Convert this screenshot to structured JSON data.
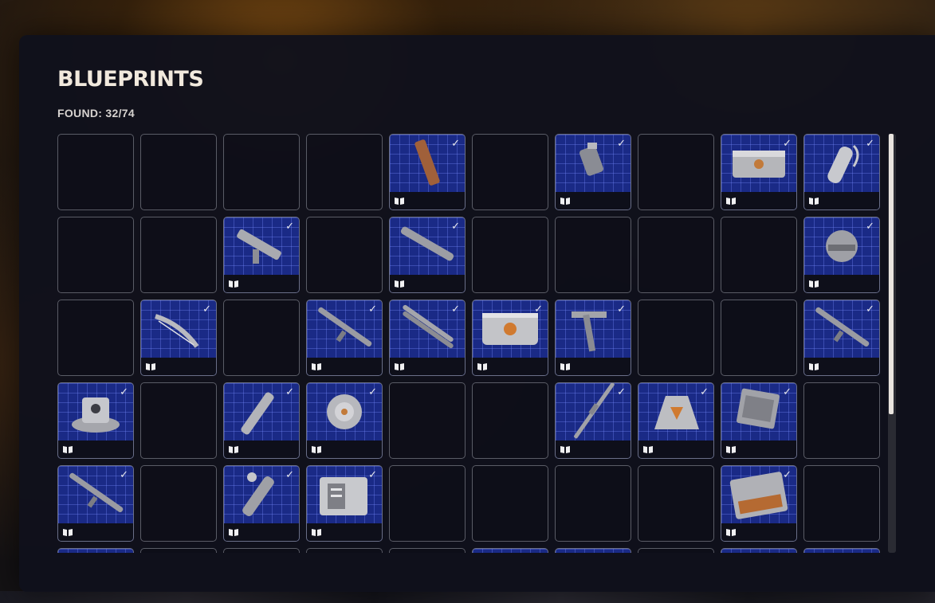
{
  "header": {
    "title": "BLUEPRINTS",
    "found_text": "FOUND: 32/74"
  },
  "colors": {
    "found_bg": "#1a2a86",
    "panel_bg": "#10111c",
    "title": "#f1e9dd"
  },
  "grid": {
    "columns": 10,
    "cells": [
      {
        "found": false
      },
      {
        "found": false
      },
      {
        "found": false
      },
      {
        "found": false
      },
      {
        "found": true,
        "icon": "canister-icon"
      },
      {
        "found": false
      },
      {
        "found": true,
        "icon": "device-icon"
      },
      {
        "found": false
      },
      {
        "found": true,
        "icon": "crate-icon"
      },
      {
        "found": true,
        "icon": "tank-icon"
      },
      {
        "found": false
      },
      {
        "found": false
      },
      {
        "found": true,
        "icon": "smg-icon"
      },
      {
        "found": false
      },
      {
        "found": true,
        "icon": "launcher-icon"
      },
      {
        "found": false
      },
      {
        "found": false
      },
      {
        "found": false
      },
      {
        "found": false
      },
      {
        "found": true,
        "icon": "helmet-icon"
      },
      {
        "found": false
      },
      {
        "found": true,
        "icon": "bow-icon"
      },
      {
        "found": false
      },
      {
        "found": true,
        "icon": "rifle-icon"
      },
      {
        "found": true,
        "icon": "shotgun-icon"
      },
      {
        "found": true,
        "icon": "supply-crate-icon"
      },
      {
        "found": true,
        "icon": "tool-icon"
      },
      {
        "found": false
      },
      {
        "found": false
      },
      {
        "found": true,
        "icon": "rifle-icon"
      },
      {
        "found": true,
        "icon": "turret-icon"
      },
      {
        "found": false
      },
      {
        "found": true,
        "icon": "flashlight-icon"
      },
      {
        "found": true,
        "icon": "mine-icon"
      },
      {
        "found": false
      },
      {
        "found": false
      },
      {
        "found": true,
        "icon": "sniper-icon"
      },
      {
        "found": true,
        "icon": "beacon-icon"
      },
      {
        "found": true,
        "icon": "shield-icon"
      },
      {
        "found": false
      },
      {
        "found": true,
        "icon": "rifle-icon"
      },
      {
        "found": false
      },
      {
        "found": true,
        "icon": "grenade-launcher-icon"
      },
      {
        "found": true,
        "icon": "ammo-box-icon"
      },
      {
        "found": false
      },
      {
        "found": false
      },
      {
        "found": false
      },
      {
        "found": false
      },
      {
        "found": true,
        "icon": "toolcase-icon"
      },
      {
        "found": false
      },
      {
        "found": true,
        "icon": "rifle-icon"
      },
      {
        "found": false
      },
      {
        "found": false
      },
      {
        "found": false
      },
      {
        "found": false
      },
      {
        "found": true,
        "icon": "crate-icon"
      },
      {
        "found": true,
        "icon": "device-icon"
      },
      {
        "found": false
      },
      {
        "found": true,
        "icon": "crate-icon"
      },
      {
        "found": true,
        "icon": "rifle-icon"
      }
    ]
  },
  "scroll": {
    "position_fraction": 0.0,
    "visible_fraction": 0.67
  }
}
